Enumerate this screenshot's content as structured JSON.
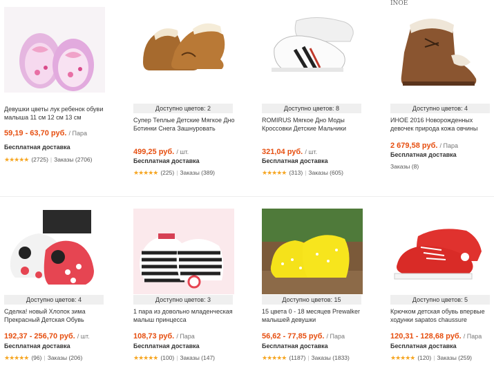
{
  "products": [
    {
      "colors": "",
      "title": "Девушки цветы лук ребенок обуви малыша 11 см 12 см 13 см",
      "price": "59,19 - 63,70 руб.",
      "unit": "/ Пара",
      "shipping": "Бесплатная доставка",
      "rating_count": "(2725)",
      "orders": "Заказы (2706)",
      "image": "pink-floral-baby-shoes"
    },
    {
      "colors": "Доступно цветов: 2",
      "title": "Супер Теплые Детские Мягкое Дно Ботинки Снега Зашнуровать",
      "price": "499,25 руб.",
      "unit": "/ шт.",
      "shipping": "Бесплатная доставка",
      "rating_count": "(225)",
      "orders": "Заказы (389)",
      "image": "brown-fur-snow-boots"
    },
    {
      "colors": "Доступно цветов: 8",
      "title": "ROMIRUS Мягкое Дно Моды Кроссовки Детские Мальчики",
      "price": "321,04 руб.",
      "unit": "/ шт.",
      "shipping": "Бесплатная доставка",
      "rating_count": "(313)",
      "orders": "Заказы (605)",
      "image": "white-striped-sneakers"
    },
    {
      "colors": "Доступно цветов: 4",
      "title": "ИНОЕ 2016 Новорожденных девочек природа кожа овчины",
      "price": "2 679,58 руб.",
      "unit": "/ Пара",
      "shipping": "Бесплатная доставка",
      "rating_count": "",
      "orders": "Заказы (8)",
      "brandmark": "INOE",
      "image": "brown-leather-fur-boot"
    },
    {
      "colors": "Доступно цветов: 4",
      "title": "Сделка! новый Хлопок зима Прекрасный Детская Обувь",
      "price": "192,37 - 256,70 руб.",
      "unit": "/ шт.",
      "shipping": "Бесплатная доставка",
      "rating_count": "(96)",
      "orders": "Заказы (206)",
      "image": "ladybug-baby-shoes"
    },
    {
      "colors": "Доступно цветов: 3",
      "title": "1 пара из довольно младенческая малыш принцесса",
      "price": "108,73 руб.",
      "unit": "/ Пара",
      "shipping": "Бесплатная доставка",
      "rating_count": "(100)",
      "orders": "Заказы (147)",
      "image": "black-white-striped-flats"
    },
    {
      "colors": "Доступно цветов: 15",
      "title": "15 цвета 0 - 18 месяцев Prewalker малышей девушки",
      "price": "56,62 - 77,85 руб.",
      "unit": "/ Пара",
      "shipping": "Бесплатная доставка",
      "rating_count": "(1187)",
      "orders": "Заказы (1833)",
      "image": "yellow-dotted-shoes"
    },
    {
      "colors": "Доступно цветов: 5",
      "title": "Крючком детская обувь впервые ходунки sapatos chaussure",
      "price": "120,31 - 128,68 руб.",
      "unit": "/ Пара",
      "shipping": "Бесплатная доставка",
      "rating_count": "(120)",
      "orders": "Заказы (259)",
      "image": "red-canvas-sneakers"
    }
  ],
  "accent": "#e64e0f",
  "star_color": "#f6a623"
}
